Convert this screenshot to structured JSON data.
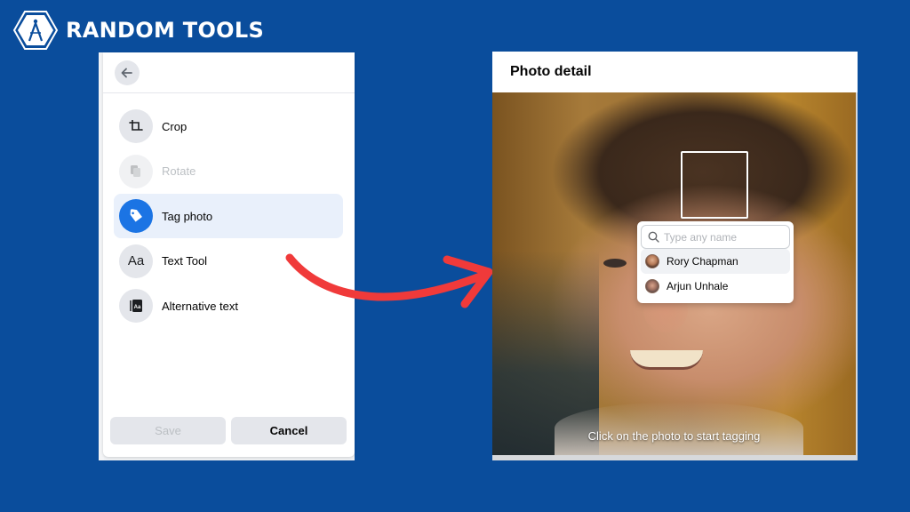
{
  "brand": {
    "name": "RANDOM TOOLS",
    "logo_icon": "compass-hexagon-icon"
  },
  "left_panel": {
    "back_icon": "arrow-left-icon",
    "menu_items": [
      {
        "label": "Crop",
        "icon": "crop-icon",
        "state": "normal"
      },
      {
        "label": "Rotate",
        "icon": "rotate-icon",
        "state": "disabled"
      },
      {
        "label": "Tag photo",
        "icon": "tag-icon",
        "state": "active"
      },
      {
        "label": "Text Tool",
        "icon": "text-aa-icon",
        "state": "normal"
      },
      {
        "label": "Alternative text",
        "icon": "alt-text-icon",
        "state": "normal"
      }
    ],
    "save_label": "Save",
    "cancel_label": "Cancel"
  },
  "right_panel": {
    "title": "Photo detail",
    "tag_search": {
      "placeholder": "Type any name",
      "value": ""
    },
    "suggestions": [
      {
        "name": "Rory Chapman",
        "highlighted": true
      },
      {
        "name": "Arjun Unhale",
        "highlighted": false
      }
    ],
    "hint": "Click on the photo to start tagging"
  },
  "colors": {
    "background": "#0a4d9c",
    "accent": "#1b74e4",
    "arrow": "#f03a3a",
    "active_item_bg": "#e9f0fb"
  }
}
